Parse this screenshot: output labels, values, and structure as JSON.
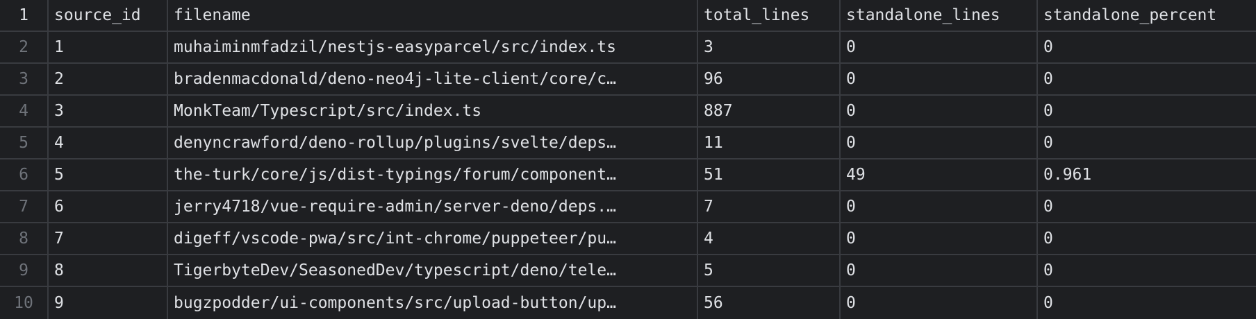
{
  "table": {
    "columns": [
      "source_id",
      "filename",
      "total_lines",
      "standalone_lines",
      "standalone_percent"
    ],
    "header_row_number": "1",
    "rows": [
      {
        "num": "2",
        "source_id": "1",
        "filename": "muhaiminmfadzil/nestjs-easyparcel/src/index.ts",
        "total_lines": "3",
        "standalone_lines": "0",
        "standalone_percent": "0"
      },
      {
        "num": "3",
        "source_id": "2",
        "filename": "bradenmacdonald/deno-neo4j-lite-client/core/c…",
        "total_lines": "96",
        "standalone_lines": "0",
        "standalone_percent": "0"
      },
      {
        "num": "4",
        "source_id": "3",
        "filename": "MonkTeam/Typescript/src/index.ts",
        "total_lines": "887",
        "standalone_lines": "0",
        "standalone_percent": "0"
      },
      {
        "num": "5",
        "source_id": "4",
        "filename": "denyncrawford/deno-rollup/plugins/svelte/deps…",
        "total_lines": "11",
        "standalone_lines": "0",
        "standalone_percent": "0"
      },
      {
        "num": "6",
        "source_id": "5",
        "filename": "the-turk/core/js/dist-typings/forum/component…",
        "total_lines": "51",
        "standalone_lines": "49",
        "standalone_percent": "0.961"
      },
      {
        "num": "7",
        "source_id": "6",
        "filename": "jerry4718/vue-require-admin/server-deno/deps.…",
        "total_lines": "7",
        "standalone_lines": "0",
        "standalone_percent": "0"
      },
      {
        "num": "8",
        "source_id": "7",
        "filename": "digeff/vscode-pwa/src/int-chrome/puppeteer/pu…",
        "total_lines": "4",
        "standalone_lines": "0",
        "standalone_percent": "0"
      },
      {
        "num": "9",
        "source_id": "8",
        "filename": "TigerbyteDev/SeasonedDev/typescript/deno/tele…",
        "total_lines": "5",
        "standalone_lines": "0",
        "standalone_percent": "0"
      },
      {
        "num": "10",
        "source_id": "9",
        "filename": "bugzpodder/ui-components/src/upload-button/up…",
        "total_lines": "56",
        "standalone_lines": "0",
        "standalone_percent": "0"
      }
    ]
  }
}
